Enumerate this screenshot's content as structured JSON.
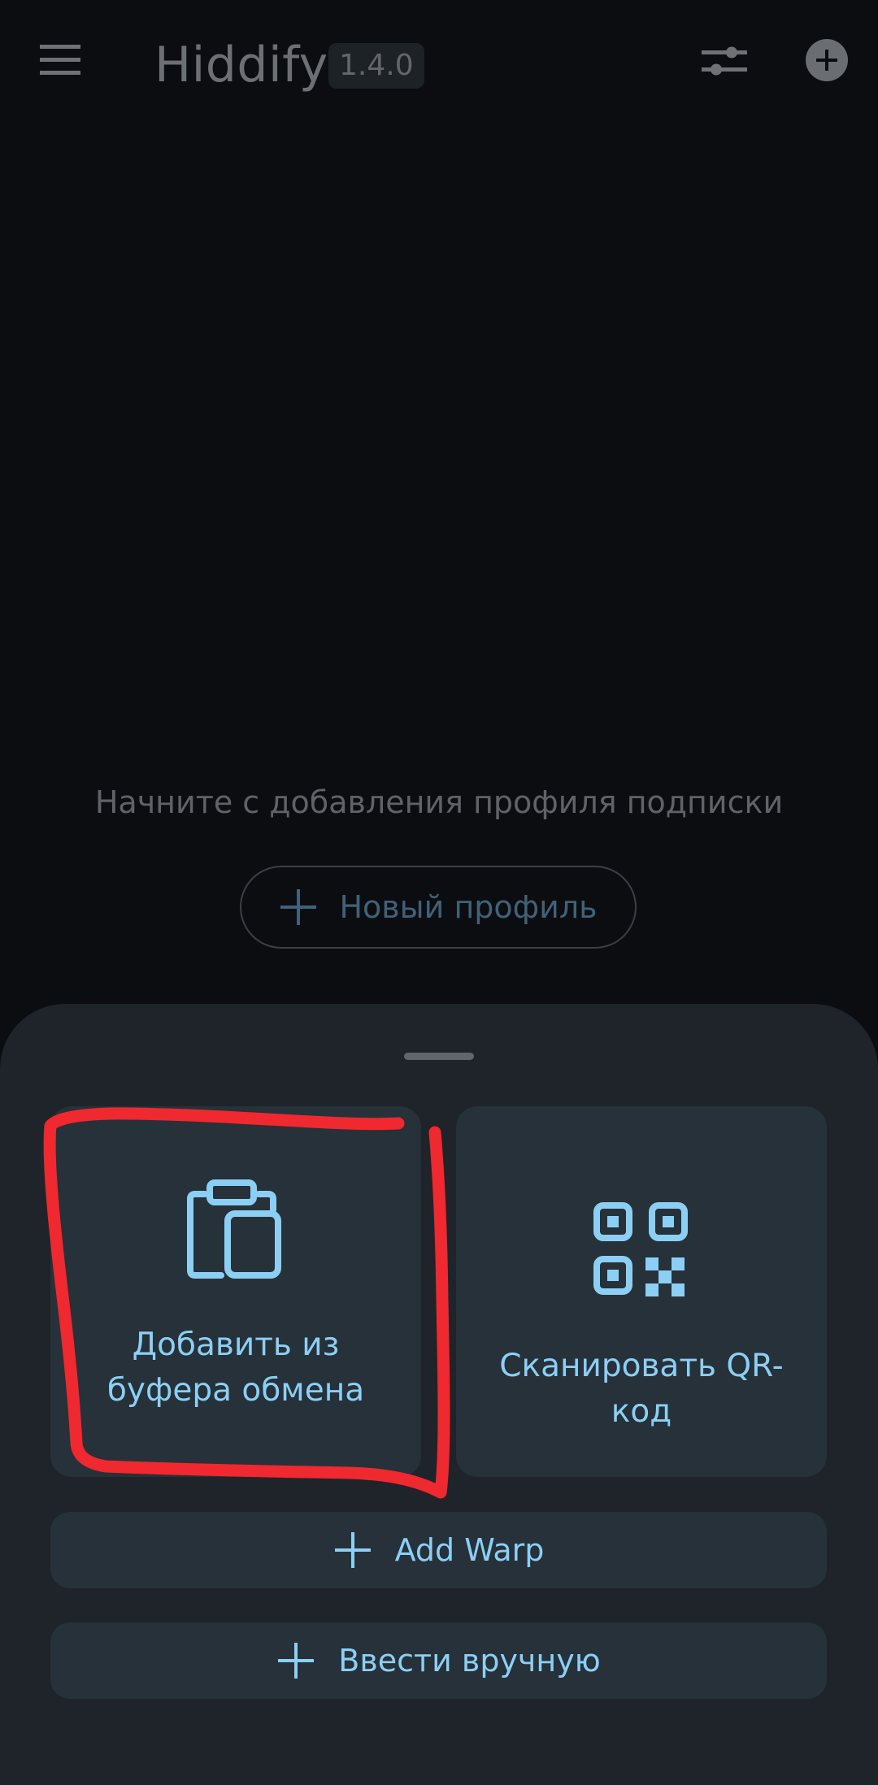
{
  "app": {
    "title": "Hiddify",
    "version": "1.4.0"
  },
  "header": {
    "menu_icon": "menu-icon",
    "filter_icon": "sliders-icon",
    "add_icon": "add-circle-icon"
  },
  "empty_state": {
    "message": "Начните с добавления профиля подписки",
    "new_profile_label": "Новый профиль"
  },
  "sheet": {
    "tiles": [
      {
        "label": "Добавить из буфера обмена",
        "icon": "clipboard-icon"
      },
      {
        "label": "Сканировать QR-код",
        "icon": "qr-code-icon"
      }
    ],
    "buttons": [
      {
        "label": "Add Warp",
        "icon": "plus-icon"
      },
      {
        "label": "Ввести вручную",
        "icon": "plus-icon"
      }
    ]
  },
  "colors": {
    "background": "#0b0d10",
    "sheet": "#1e2429",
    "tile": "#263139",
    "accent": "#8ccff5",
    "annotation": "#f0282f"
  }
}
